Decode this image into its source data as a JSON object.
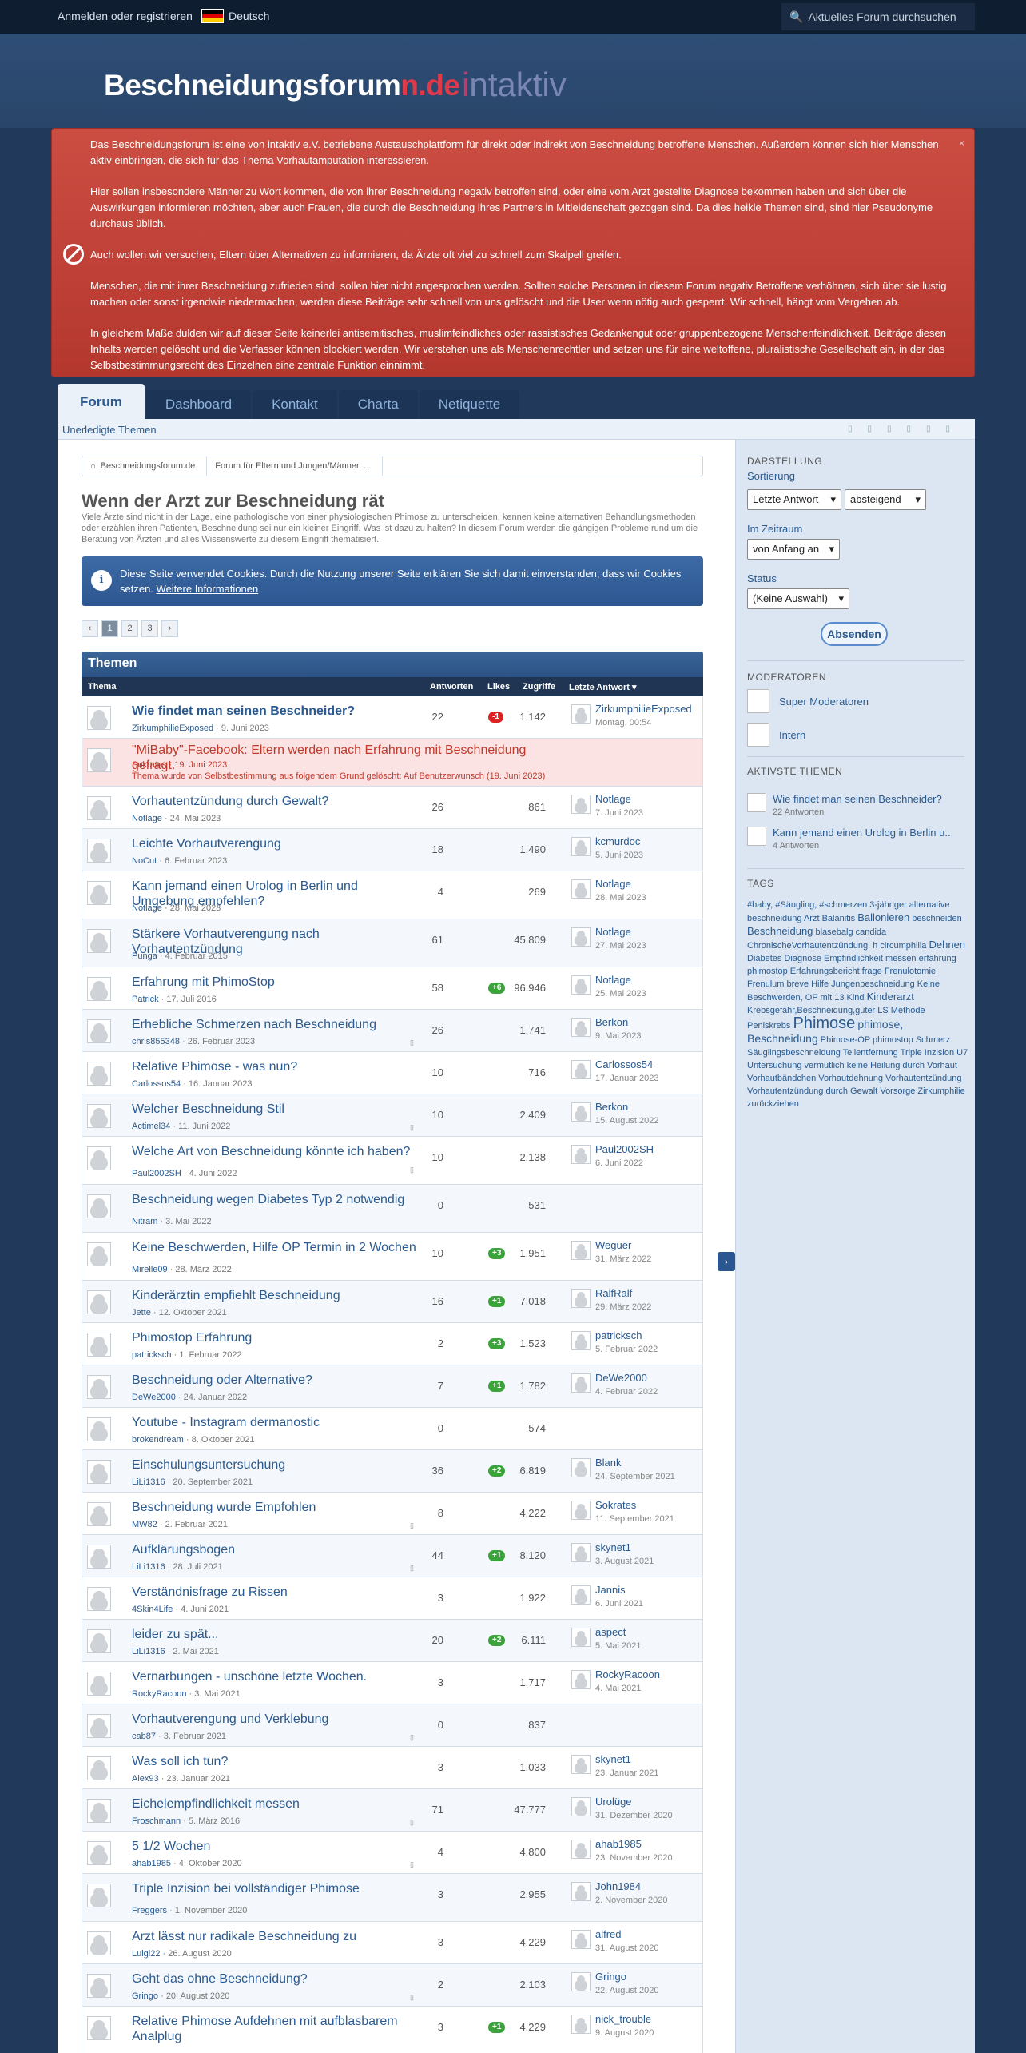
{
  "topbar": {
    "login": "Anmelden oder registrieren",
    "lang": "Deutsch",
    "search_placeholder": "Aktuelles Forum durchsuchen"
  },
  "logo": {
    "main": "Beschneidungsforum",
    "suffix": "n.de",
    "partner_a": "i",
    "partner_b": "ntaktiv"
  },
  "notice": {
    "close": "×",
    "p1a": "Das Beschneidungsforum ist eine von ",
    "p1link": "intaktiv e.V.",
    "p1b": " betriebene Austauschplattform für direkt oder indirekt von Beschneidung betroffene Menschen. Außerdem können sich hier Menschen aktiv einbringen, die sich für das Thema Vorhautamputation interessieren.",
    "p2": "Hier sollen insbesondere Männer zu Wort kommen, die von ihrer Beschneidung negativ betroffen sind, oder eine vom Arzt gestellte Diagnose bekommen haben und sich über die Auswirkungen informieren möchten, aber auch Frauen, die durch die Beschneidung ihres Partners in Mitleidenschaft gezogen sind. Da dies heikle Themen sind, sind hier Pseudonyme durchaus üblich.",
    "p3": "Auch wollen wir versuchen, Eltern über Alternativen zu informieren, da Ärzte oft viel zu schnell zum Skalpell greifen.",
    "p4": "Menschen, die mit ihrer Beschneidung zufrieden sind, sollen hier nicht angesprochen werden. Sollten solche Personen in diesem Forum negativ Betroffene verhöhnen, sich über sie lustig machen oder sonst irgendwie niedermachen, werden diese Beiträge sehr schnell von uns gelöscht und die User wenn nötig auch gesperrt. Wir schnell, hängt vom Vergehen ab.",
    "p5": "In gleichem Maße dulden wir auf dieser Seite keinerlei antisemitisches, muslimfeindliches oder rassistisches Gedankengut oder gruppenbezogene Menschenfeindlichkeit. Beiträge diesen Inhalts werden gelöscht und die Verfasser können blockiert werden. Wir verstehen uns als Menschenrechtler und setzen uns für eine weltoffene, pluralistische Gesellschaft ein, in der das Selbstbestimmungsrecht des Einzelnen eine zentrale Funktion einnimmt."
  },
  "nav": {
    "tabs": [
      "Forum",
      "Dashboard",
      "Kontakt",
      "Charta",
      "Netiquette"
    ],
    "sub": "Unerledigte Themen"
  },
  "breadcrumb": [
    "Beschneidungsforum.de",
    "Forum für Eltern und Jungen/Männer, ..."
  ],
  "page": {
    "title": "Wenn der Arzt zur Beschneidung rät",
    "desc": "Viele Ärzte sind nicht in der Lage, eine pathologische von einer physiologischen Phimose zu unterscheiden, kennen keine alternativen Behandlungsmethoden oder erzählen ihren Patienten, Beschneidung sei nur ein kleiner Eingriff. Was ist dazu zu halten? In diesem Forum werden die gängigen Probleme rund um die Beratung von Ärzten und alles Wissenswerte zu diesem Eingriff thematisiert."
  },
  "cookie": {
    "text": "Diese Seite verwendet Cookies. Durch die Nutzung unserer Seite erklären Sie sich damit einverstanden, dass wir Cookies setzen. ",
    "link": "Weitere Informationen"
  },
  "pager": [
    "‹",
    "1",
    "2",
    "3",
    "›"
  ],
  "table": {
    "caption": "Themen",
    "headers": {
      "thema": "Thema",
      "antworten": "Antworten",
      "likes": "Likes",
      "zugriffe": "Zugriffe",
      "letzte": "Letzte Antwort ▾"
    }
  },
  "threads": [
    {
      "title": "Wie findet man seinen Beschneider?",
      "author": "ZirkumphilieExposed",
      "date": "9. Juni 2023",
      "ans": "22",
      "like": "-1",
      "views": "1.142",
      "luser": "ZirkumphilieExposed",
      "ldate": "Montag, 00:54",
      "bold": true
    },
    {
      "title": "\"MiBaby\"-Facebook: Eltern werden nach Erfahrung mit Beschneidung gefragt.",
      "author": "Sokrates",
      "date": "19. Juni 2023",
      "deleted": "Thema wurde von Selbstbestimmung aus folgendem Grund gelöscht: Auf Benutzerwunsch (19. Juni 2023)"
    },
    {
      "title": "Vorhautentzündung durch Gewalt?",
      "author": "Notlage",
      "date": "24. Mai 2023",
      "ans": "26",
      "like": "",
      "views": "861",
      "luser": "Notlage",
      "ldate": "7. Juni 2023"
    },
    {
      "title": "Leichte Vorhautverengung",
      "author": "NoCut",
      "date": "6. Februar 2023",
      "ans": "18",
      "like": "",
      "views": "1.490",
      "luser": "kcmurdoc",
      "ldate": "5. Juni 2023"
    },
    {
      "title": "Kann jemand einen Urolog in Berlin und Umgebung empfehlen?",
      "author": "Notlage",
      "date": "28. Mai 2023",
      "ans": "4",
      "like": "",
      "views": "269",
      "luser": "Notlage",
      "ldate": "28. Mai 2023"
    },
    {
      "title": "Stärkere Vorhautverengung nach Vorhautentzündung",
      "author": "Punga",
      "date": "4. Februar 2015",
      "ans": "61",
      "like": "",
      "views": "45.809",
      "luser": "Notlage",
      "ldate": "27. Mai 2023"
    },
    {
      "title": "Erfahrung mit PhimoStop",
      "author": "Patrick",
      "date": "17. Juli 2016",
      "ans": "58",
      "like": "+6",
      "views": "96.946",
      "luser": "Notlage",
      "ldate": "25. Mai 2023"
    },
    {
      "title": "Erhebliche Schmerzen nach Beschneidung",
      "author": "chris855348",
      "date": "26. Februar 2023",
      "ans": "26",
      "like": "",
      "views": "1.741",
      "luser": "Berkon",
      "ldate": "9. Mai 2023",
      "pages": true
    },
    {
      "title": "Relative Phimose - was nun?",
      "author": "Carlossos54",
      "date": "16. Januar 2023",
      "ans": "10",
      "like": "",
      "views": "716",
      "luser": "Carlossos54",
      "ldate": "17. Januar 2023"
    },
    {
      "title": "Welcher Beschneidung Stil",
      "author": "Actimel34",
      "date": "11. Juni 2022",
      "ans": "10",
      "like": "",
      "views": "2.409",
      "luser": "Berkon",
      "ldate": "15. August 2022",
      "pages": true
    },
    {
      "title": "Welche Art von Beschneidung könnte ich haben?",
      "author": "Paul2002SH",
      "date": "4. Juni 2022",
      "ans": "10",
      "like": "",
      "views": "2.138",
      "luser": "Paul2002SH",
      "ldate": "6. Juni 2022",
      "pages": true
    },
    {
      "title": "Beschneidung wegen Diabetes Typ 2 notwendig",
      "author": "Nitram",
      "date": "3. Mai 2022",
      "ans": "0",
      "like": "",
      "views": "531",
      "luser": "",
      "ldate": ""
    },
    {
      "title": "Keine Beschwerden, Hilfe OP Termin in 2 Wochen",
      "author": "Mirelle09",
      "date": "28. März 2022",
      "ans": "10",
      "like": "+3",
      "views": "1.951",
      "luser": "Weguer",
      "ldate": "31. März 2022"
    },
    {
      "title": "Kinderärztin empfiehlt Beschneidung",
      "author": "Jette",
      "date": "12. Oktober 2021",
      "ans": "16",
      "like": "+1",
      "views": "7.018",
      "luser": "RalfRalf",
      "ldate": "29. März 2022"
    },
    {
      "title": "Phimostop Erfahrung",
      "author": "patricksch",
      "date": "1. Februar 2022",
      "ans": "2",
      "like": "+3",
      "views": "1.523",
      "luser": "patricksch",
      "ldate": "5. Februar 2022"
    },
    {
      "title": "Beschneidung oder Alternative?",
      "author": "DeWe2000",
      "date": "24. Januar 2022",
      "ans": "7",
      "like": "+1",
      "views": "1.782",
      "luser": "DeWe2000",
      "ldate": "4. Februar 2022"
    },
    {
      "title": "Youtube - Instagram dermanostic",
      "author": "brokendream",
      "date": "8. Oktober 2021",
      "ans": "0",
      "like": "",
      "views": "574",
      "luser": "",
      "ldate": ""
    },
    {
      "title": "Einschulungsuntersuchung",
      "author": "LiLi1316",
      "date": "20. September 2021",
      "ans": "36",
      "like": "+2",
      "views": "6.819",
      "luser": "Blank",
      "ldate": "24. September 2021"
    },
    {
      "title": "Beschneidung wurde Empfohlen",
      "author": "MW82",
      "date": "2. Februar 2021",
      "ans": "8",
      "like": "",
      "views": "4.222",
      "luser": "Sokrates",
      "ldate": "11. September 2021",
      "pages": true
    },
    {
      "title": "Aufklärungsbogen",
      "author": "LiLi1316",
      "date": "28. Juli 2021",
      "ans": "44",
      "like": "+1",
      "views": "8.120",
      "luser": "skynet1",
      "ldate": "3. August 2021",
      "pages": true
    },
    {
      "title": "Verständnisfrage zu Rissen",
      "author": "4Skin4Life",
      "date": "4. Juni 2021",
      "ans": "3",
      "like": "",
      "views": "1.922",
      "luser": "Jannis",
      "ldate": "6. Juni 2021"
    },
    {
      "title": "leider zu spät...",
      "author": "LiLi1316",
      "date": "2. Mai 2021",
      "ans": "20",
      "like": "+2",
      "views": "6.111",
      "luser": "aspect",
      "ldate": "5. Mai 2021"
    },
    {
      "title": "Vernarbungen - unschöne letzte Wochen.",
      "author": "RockyRacoon",
      "date": "3. Mai 2021",
      "ans": "3",
      "like": "",
      "views": "1.717",
      "luser": "RockyRacoon",
      "ldate": "4. Mai 2021"
    },
    {
      "title": "Vorhautverengung und Verklebung",
      "author": "cab87",
      "date": "3. Februar 2021",
      "ans": "0",
      "like": "",
      "views": "837",
      "luser": "",
      "ldate": "",
      "pages": true
    },
    {
      "title": "Was soll ich tun?",
      "author": "Alex93",
      "date": "23. Januar 2021",
      "ans": "3",
      "like": "",
      "views": "1.033",
      "luser": "skynet1",
      "ldate": "23. Januar 2021"
    },
    {
      "title": "Eichelempfindlichkeit messen",
      "author": "Froschmann",
      "date": "5. März 2016",
      "ans": "71",
      "like": "",
      "views": "47.777",
      "luser": "Urolüge",
      "ldate": "31. Dezember 2020",
      "pages": true
    },
    {
      "title": "5 1/2 Wochen",
      "author": "ahab1985",
      "date": "4. Oktober 2020",
      "ans": "4",
      "like": "",
      "views": "4.800",
      "luser": "ahab1985",
      "ldate": "23. November 2020",
      "pages": true
    },
    {
      "title": "Triple Inzision bei vollständiger Phimose",
      "author": "Freggers",
      "date": "1. November 2020",
      "ans": "3",
      "like": "",
      "views": "2.955",
      "luser": "John1984",
      "ldate": "2. November 2020"
    },
    {
      "title": "Arzt lässt nur radikale Beschneidung zu",
      "author": "Luigi22",
      "date": "26. August 2020",
      "ans": "3",
      "like": "",
      "views": "4.229",
      "luser": "alfred",
      "ldate": "31. August 2020"
    },
    {
      "title": "Geht das ohne Beschneidung?",
      "author": "Gringo",
      "date": "20. August 2020",
      "ans": "2",
      "like": "",
      "views": "2.103",
      "luser": "Gringo",
      "ldate": "22. August 2020",
      "pages": true
    },
    {
      "title": "Relative Phimose Aufdehnen mit aufblasbarem Analplug",
      "author": "",
      "date": "",
      "ans": "3",
      "like": "+1",
      "views": "4.229",
      "luser": "nick_trouble",
      "ldate": "9. August 2020"
    }
  ],
  "sidebar": {
    "darstellung": "DARSTELLUNG",
    "sortierung": "Sortierung",
    "sort1": "Letzte Antwort",
    "sort2": "absteigend",
    "zeitraum": "Im Zeitraum",
    "zeit": "von Anfang an",
    "status": "Status",
    "status_val": "(Keine Auswahl)",
    "submit": "Absenden",
    "moderatoren": "MODERATOREN",
    "mod1": "Super Moderatoren",
    "mod2": "Intern",
    "aktive": "AKTIVSTE THEMEN",
    "at1": "Wie findet man seinen Beschneider?",
    "at1s": "22 Antworten",
    "at2": "Kann jemand einen Urolog in Berlin u...",
    "at2s": "4 Antworten",
    "tags": "TAGS"
  }
}
